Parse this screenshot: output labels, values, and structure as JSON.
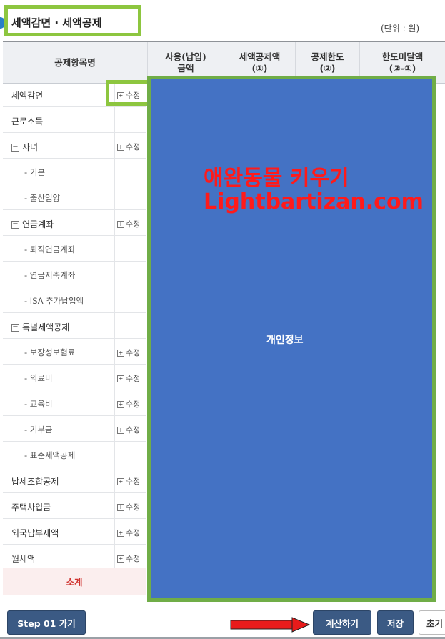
{
  "title": "세액감면 · 세액공제",
  "unit": "(단위 : 원)",
  "columns": {
    "item": "공제항목명",
    "amount": [
      "사용(납입)",
      "금액"
    ],
    "credit": [
      "세액공제액",
      "(①)"
    ],
    "limit": [
      "공제한도",
      "(②)"
    ],
    "shortfall": [
      "한도미달액",
      "(②-①)"
    ]
  },
  "edit_label": "수정",
  "rows": [
    {
      "label": "세액감면",
      "edit": true
    },
    {
      "label": "근로소득",
      "edit": false
    },
    {
      "label": "자녀",
      "edit": true,
      "collapse": true
    },
    {
      "label": "- 기본",
      "edit": false,
      "sub": true
    },
    {
      "label": "- 출산입양",
      "edit": false,
      "sub": true
    },
    {
      "label": "연금계좌",
      "edit": true,
      "collapse": true
    },
    {
      "label": "- 퇴직연금계좌",
      "edit": false,
      "sub": true
    },
    {
      "label": "- 연금저축계좌",
      "edit": false,
      "sub": true
    },
    {
      "label": "- ISA 추가납입액",
      "edit": false,
      "sub": true
    },
    {
      "label": "특별세액공제",
      "edit": false,
      "collapse": true
    },
    {
      "label": "- 보장성보험료",
      "edit": true,
      "sub": true
    },
    {
      "label": "- 의료비",
      "edit": true,
      "sub": true
    },
    {
      "label": "- 교육비",
      "edit": true,
      "sub": true
    },
    {
      "label": "- 기부금",
      "edit": true,
      "sub": true
    },
    {
      "label": "- 표준세액공제",
      "edit": false,
      "sub": true
    },
    {
      "label": "납세조합공제",
      "edit": true
    },
    {
      "label": "주택차입금",
      "edit": true
    },
    {
      "label": "외국납부세액",
      "edit": true
    },
    {
      "label": "월세액",
      "edit": true
    }
  ],
  "subtotal": "소계",
  "watermark": {
    "line1": "애완동물 키우기",
    "line2": "Lightbartizan.com"
  },
  "private_label": "개인정보",
  "buttons": {
    "step": "Step 01 가기",
    "calc": "계산하기",
    "save": "저장",
    "reset": "초기"
  },
  "colors": {
    "accent_green": "#8dc63f",
    "panel_blue": "#4472c4",
    "button_navy": "#3b5a84",
    "subtotal_red": "#d0332f"
  }
}
